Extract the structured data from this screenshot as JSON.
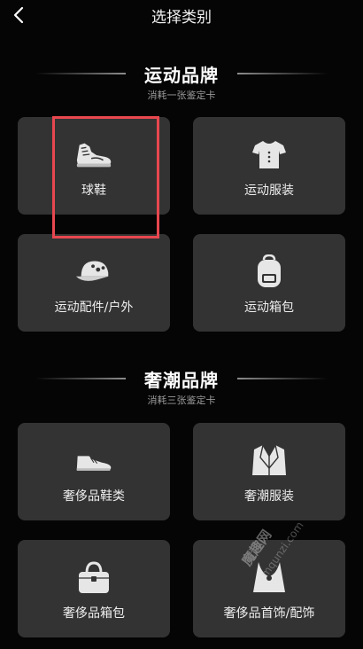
{
  "header": {
    "title": "选择类别",
    "back_icon": "chevron-left-icon"
  },
  "sections": [
    {
      "title": "运动品牌",
      "subtitle": "消耗一张鉴定卡",
      "items": [
        {
          "label": "球鞋",
          "icon": "sneaker-icon"
        },
        {
          "label": "运动服装",
          "icon": "tshirt-icon"
        },
        {
          "label": "运动配件/户外",
          "icon": "cap-icon"
        },
        {
          "label": "运动箱包",
          "icon": "backpack-icon"
        }
      ]
    },
    {
      "title": "奢潮品牌",
      "subtitle": "消耗三张鉴定卡",
      "items": [
        {
          "label": "奢侈品鞋类",
          "icon": "leather-shoe-icon"
        },
        {
          "label": "奢潮服装",
          "icon": "suit-icon"
        },
        {
          "label": "奢侈品箱包",
          "icon": "handbag-icon"
        },
        {
          "label": "奢侈品首饰/配饰",
          "icon": "necklace-icon"
        }
      ]
    }
  ],
  "watermark": {
    "brand": "魔趣网",
    "domain": "mqunzi.com"
  },
  "colors": {
    "background": "#050505",
    "card": "#333333",
    "highlight": "#e8474f"
  }
}
